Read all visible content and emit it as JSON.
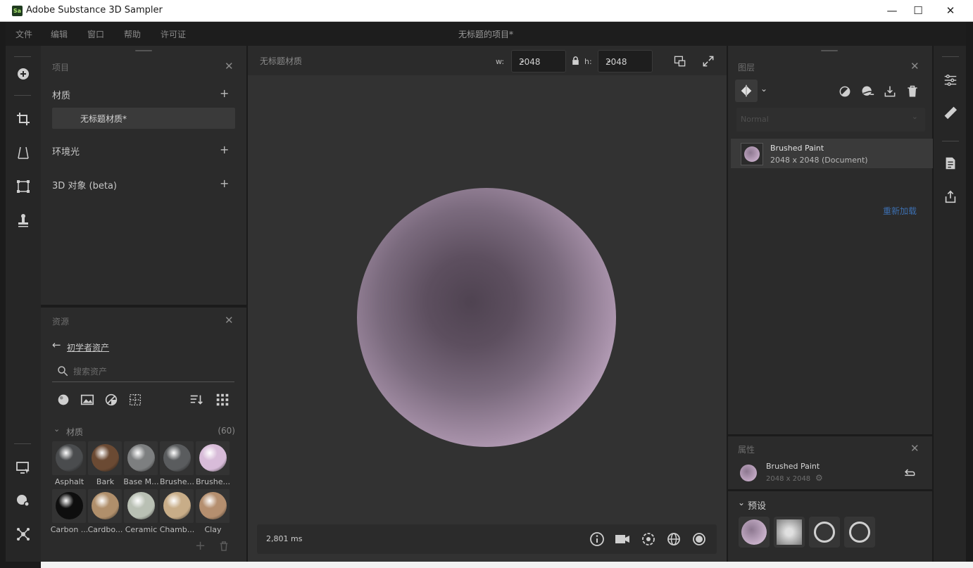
{
  "window": {
    "app_icon_text": "Sa",
    "title": "Adobe Substance 3D Sampler",
    "controls": {
      "minimize": "—",
      "maximize": "☐",
      "close": "✕"
    }
  },
  "menu": {
    "items": [
      "文件",
      "编辑",
      "窗口",
      "帮助",
      "许可证"
    ],
    "project_title": "无标题的项目*"
  },
  "project_panel": {
    "title": "项目",
    "sections": [
      {
        "label": "材质",
        "items": [
          "无标题材质*"
        ]
      },
      {
        "label": "环境光"
      },
      {
        "label": "3D 对象 (beta)"
      }
    ]
  },
  "assets_panel": {
    "title": "资源",
    "breadcrumb": "初学者资产",
    "search_placeholder": "搜索资产",
    "category": "材质",
    "count": "(60)",
    "materials": [
      {
        "name": "Asphalt",
        "color": "#4a4c4e"
      },
      {
        "name": "Bark",
        "color": "#6b4a33"
      },
      {
        "name": "Base M...",
        "color": "#7d7f80"
      },
      {
        "name": "Brushe...",
        "color": "#5a5c5e"
      },
      {
        "name": "Brushe...",
        "color": "#d8bcd9"
      },
      {
        "name": "Carbon ...",
        "color": "#0e0e0e"
      },
      {
        "name": "Cardbo...",
        "color": "#b08f6b"
      },
      {
        "name": "Ceramic",
        "color": "#b9c0b4"
      },
      {
        "name": "Chamb...",
        "color": "#c8ad88"
      },
      {
        "name": "Clay",
        "color": "#b58f6f"
      }
    ]
  },
  "viewport": {
    "title": "无标题材质",
    "width_label": "w:",
    "width_value": "2048",
    "height_label": "h:",
    "height_value": "2048",
    "render_time": "2,801 ms"
  },
  "layers_panel": {
    "title": "图层",
    "blend_mode": "Normal",
    "layers": [
      {
        "name": "Brushed Paint",
        "info": "2048 x 2048 (Document)"
      }
    ],
    "reload_link": "重新加载"
  },
  "properties_panel": {
    "title": "属性",
    "name": "Brushed Paint",
    "info": "2048 x 2048",
    "presets_label": "预设"
  },
  "colors": {
    "accent_link": "#3c6fb0",
    "sphere_tint": "#d8bcd9"
  }
}
